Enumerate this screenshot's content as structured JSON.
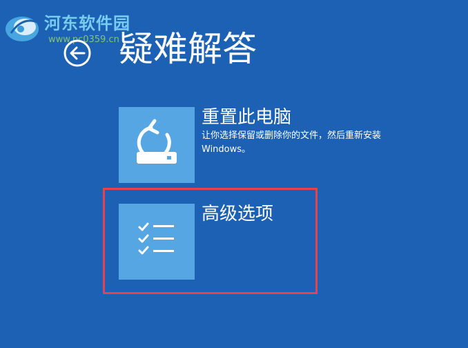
{
  "watermark": {
    "title": "河东软件园",
    "url": "www.pc0359.cn"
  },
  "header": {
    "title": "疑难解答",
    "back_icon": "back-arrow-icon"
  },
  "options": [
    {
      "title": "重置此电脑",
      "description": "让你选择保留或删除你的文件，然后重新安装 Windows。",
      "icon": "reset-pc-icon"
    },
    {
      "title": "高级选项",
      "icon": "checklist-icon"
    }
  ],
  "colors": {
    "background": "#1c61b4",
    "tile": "#55a6e2",
    "highlight": "#e8434b"
  }
}
